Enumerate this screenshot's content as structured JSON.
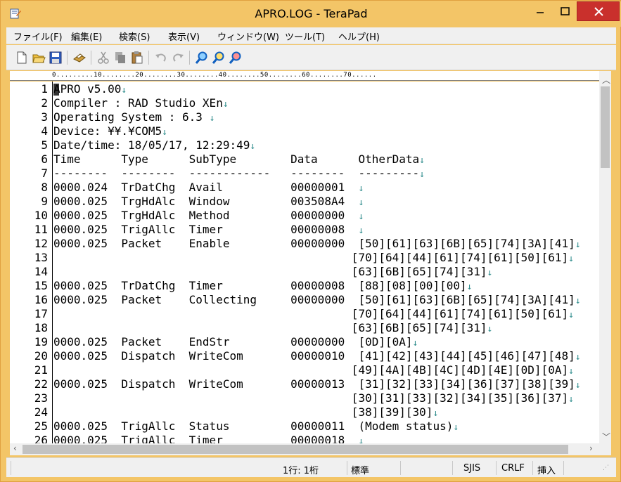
{
  "window": {
    "title": "APRO.LOG - TeraPad"
  },
  "menu": [
    "ファイル(F)",
    "編集(E)",
    "検索(S)",
    "表示(V)",
    "ウィンドウ(W)",
    "ツール(T)",
    "ヘルプ(H)"
  ],
  "toolbar_icons": [
    "new-file-icon",
    "open-folder-icon",
    "save-icon",
    "print-icon",
    "cut-icon",
    "copy-icon",
    "paste-icon",
    "undo-icon",
    "redo-icon",
    "find-icon",
    "find-next-icon",
    "find-prev-icon"
  ],
  "ruler": {
    "text": "0.........10........20........30........40........50........60........70......"
  },
  "editor": {
    "eol_mark": "↓",
    "lines": [
      {
        "n": "1",
        "text": "APRO v5.00",
        "eol": true
      },
      {
        "n": "2",
        "text": "Compiler : RAD Studio XEn",
        "eol": true
      },
      {
        "n": "3",
        "text": "Operating System : 6.3 ",
        "eol": true
      },
      {
        "n": "4",
        "text": "Device: ¥¥.¥COM5",
        "eol": true
      },
      {
        "n": "5",
        "text": "Date/time: 18/05/17, 12:29:49",
        "eol": true
      },
      {
        "n": "6",
        "text": "Time      Type      SubType        Data      OtherData",
        "eol": true
      },
      {
        "n": "7",
        "text": "--------  --------  ------------   --------  ---------",
        "eol": true
      },
      {
        "n": "8",
        "text": "0000.024  TrDatChg  Avail          00000001  ",
        "eol": true
      },
      {
        "n": "9",
        "text": "0000.025  TrgHdAlc  Window         003508A4  ",
        "eol": true
      },
      {
        "n": "10",
        "text": "0000.025  TrgHdAlc  Method         00000000  ",
        "eol": true
      },
      {
        "n": "11",
        "text": "0000.025  TrigAllc  Timer          00000008  ",
        "eol": true
      },
      {
        "n": "12",
        "text": "0000.025  Packet    Enable         00000000  [50][61][63][6B][65][74][3A][41]",
        "eol": true
      },
      {
        "n": "13",
        "text": "                                            [70][64][44][61][74][61][50][61]",
        "eol": true
      },
      {
        "n": "14",
        "text": "                                            [63][6B][65][74][31]",
        "eol": true
      },
      {
        "n": "15",
        "text": "0000.025  TrDatChg  Timer          00000008  [88][08][00][00]",
        "eol": true
      },
      {
        "n": "16",
        "text": "0000.025  Packet    Collecting     00000000  [50][61][63][6B][65][74][3A][41]",
        "eol": true
      },
      {
        "n": "17",
        "text": "                                            [70][64][44][61][74][61][50][61]",
        "eol": true
      },
      {
        "n": "18",
        "text": "                                            [63][6B][65][74][31]",
        "eol": true
      },
      {
        "n": "19",
        "text": "0000.025  Packet    EndStr         00000000  [0D][0A]",
        "eol": true
      },
      {
        "n": "20",
        "text": "0000.025  Dispatch  WriteCom       00000010  [41][42][43][44][45][46][47][48]",
        "eol": true
      },
      {
        "n": "21",
        "text": "                                            [49][4A][4B][4C][4D][4E][0D][0A]",
        "eol": true
      },
      {
        "n": "22",
        "text": "0000.025  Dispatch  WriteCom       00000013  [31][32][33][34][36][37][38][39]",
        "eol": true
      },
      {
        "n": "23",
        "text": "                                            [30][31][33][32][34][35][36][37]",
        "eol": true
      },
      {
        "n": "24",
        "text": "                                            [38][39][30]",
        "eol": true
      },
      {
        "n": "25",
        "text": "0000.025  TrigAllc  Status         00000011  (Modem status)",
        "eol": true
      },
      {
        "n": "26",
        "text": "0000.025  TrigAllc  Timer          00000018  ",
        "eol": true
      }
    ]
  },
  "status": {
    "position": "1行:  1桁",
    "mode": "標準",
    "encoding": "SJIS",
    "line_ending": "CRLF",
    "insert_mode": "挿入"
  },
  "colors": {
    "titlebar": "#f3c567",
    "close": "#c9302c",
    "eol": "#2a8a8a"
  }
}
